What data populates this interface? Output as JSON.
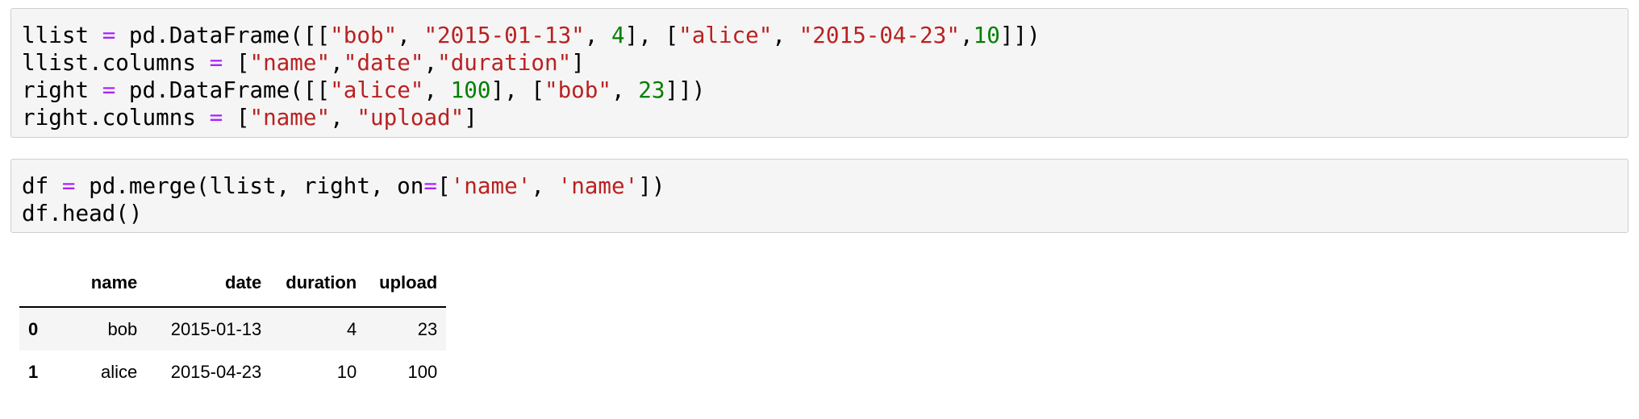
{
  "cells": [
    {
      "lines": [
        [
          {
            "t": "llist "
          },
          {
            "t": "=",
            "k": "op"
          },
          {
            "t": " pd.DataFrame([["
          },
          {
            "t": "\"bob\"",
            "k": "str"
          },
          {
            "t": ", "
          },
          {
            "t": "\"2015-01-13\"",
            "k": "str"
          },
          {
            "t": ", "
          },
          {
            "t": "4",
            "k": "num"
          },
          {
            "t": "], ["
          },
          {
            "t": "\"alice\"",
            "k": "str"
          },
          {
            "t": ", "
          },
          {
            "t": "\"2015-04-23\"",
            "k": "str"
          },
          {
            "t": ","
          },
          {
            "t": "10",
            "k": "num"
          },
          {
            "t": "]])"
          }
        ],
        [
          {
            "t": "llist.columns "
          },
          {
            "t": "=",
            "k": "op"
          },
          {
            "t": " ["
          },
          {
            "t": "\"name\"",
            "k": "str"
          },
          {
            "t": ","
          },
          {
            "t": "\"date\"",
            "k": "str"
          },
          {
            "t": ","
          },
          {
            "t": "\"duration\"",
            "k": "str"
          },
          {
            "t": "]"
          }
        ],
        [
          {
            "t": "right "
          },
          {
            "t": "=",
            "k": "op"
          },
          {
            "t": " pd.DataFrame([["
          },
          {
            "t": "\"alice\"",
            "k": "str"
          },
          {
            "t": ", "
          },
          {
            "t": "100",
            "k": "num"
          },
          {
            "t": "], ["
          },
          {
            "t": "\"bob\"",
            "k": "str"
          },
          {
            "t": ", "
          },
          {
            "t": "23",
            "k": "num"
          },
          {
            "t": "]])"
          }
        ],
        [
          {
            "t": "right.columns "
          },
          {
            "t": "=",
            "k": "op"
          },
          {
            "t": " ["
          },
          {
            "t": "\"name\"",
            "k": "str"
          },
          {
            "t": ", "
          },
          {
            "t": "\"upload\"",
            "k": "str"
          },
          {
            "t": "]"
          }
        ]
      ]
    },
    {
      "lines": [
        [
          {
            "t": "df "
          },
          {
            "t": "=",
            "k": "op"
          },
          {
            "t": " pd.merge(llist, right, on"
          },
          {
            "t": "=",
            "k": "op"
          },
          {
            "t": "["
          },
          {
            "t": "'name'",
            "k": "str"
          },
          {
            "t": ", "
          },
          {
            "t": "'name'",
            "k": "str"
          },
          {
            "t": "])"
          }
        ],
        [
          {
            "t": "df.head()"
          }
        ]
      ]
    }
  ],
  "output_table": {
    "columns": [
      "",
      "name",
      "date",
      "duration",
      "upload"
    ],
    "rows": [
      [
        "0",
        "bob",
        "2015-01-13",
        "4",
        "23"
      ],
      [
        "1",
        "alice",
        "2015-04-23",
        "10",
        "100"
      ]
    ]
  },
  "colors": {
    "operator": "#aa22ff",
    "string": "#ba2121",
    "number": "#008000",
    "cell_background": "#f5f5f5",
    "cell_border": "#cfcfcf"
  }
}
